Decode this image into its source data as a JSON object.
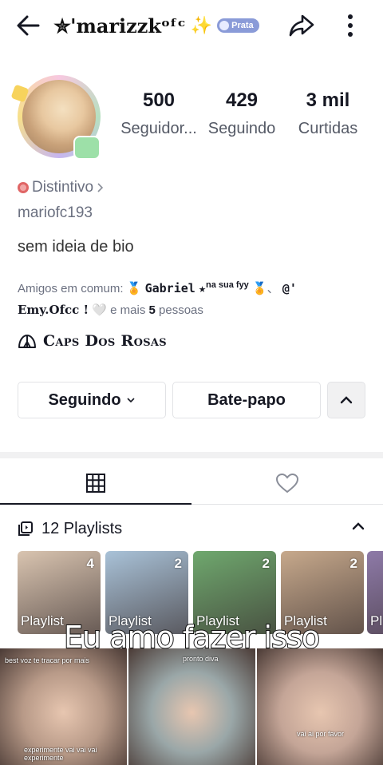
{
  "header": {
    "title": "✮'marizzkᵒᶠᶜ",
    "title_emoji": "✨",
    "badge_label": "Prata",
    "icons": {
      "back": "back-arrow-icon",
      "share": "share-icon",
      "more": "more-vertical-icon"
    }
  },
  "profile": {
    "stats": [
      {
        "value": "500",
        "label": "Seguidor..."
      },
      {
        "value": "429",
        "label": "Seguindo"
      },
      {
        "value": "3 mil",
        "label": "Curtidas"
      }
    ],
    "distintivo_label": "Distintivo",
    "username": "mariofc193",
    "bio": "sem ideia de bio",
    "friends": {
      "prefix": "Amigos em comum:",
      "friend1_name": "Gabriel",
      "friend1_suffix": "na sua fyy",
      "friend2_prefix": "@'",
      "friend2_name": "Emy.Ofcc !",
      "heart": "🤍",
      "and_more": "e mais",
      "more_count": "5",
      "more_suffix": "pessoas"
    },
    "group_name": "Caps Dos Rosas"
  },
  "actions": {
    "following_label": "Seguindo",
    "chat_label": "Bate-papo"
  },
  "tabs": [
    {
      "name": "videos",
      "icon": "grid-icon",
      "active": true
    },
    {
      "name": "liked",
      "icon": "heart-outline-icon",
      "active": false
    }
  ],
  "playlists": {
    "title": "12 Playlists",
    "items": [
      {
        "count": "4",
        "label": "Playlist",
        "color": "#d9c4b0"
      },
      {
        "count": "2",
        "label": "Playlist",
        "color": "#a9c2d8"
      },
      {
        "count": "2",
        "label": "Playlist",
        "color": "#6fa86e"
      },
      {
        "count": "2",
        "label": "Playlist",
        "color": "#c7a98c"
      },
      {
        "count": "",
        "label": "Pl",
        "color": "#8e7aa8"
      }
    ]
  },
  "videos": [
    {
      "caption": "best voz te tracar por mais",
      "caption2": "experimente vai vai vai experimente",
      "color": "#b89a88"
    },
    {
      "caption": "pronto diva",
      "caption2": "",
      "color": "#9aa7a8"
    },
    {
      "caption": "",
      "caption2": "vai ai por favor",
      "color": "#c4a597"
    }
  ],
  "overlay_caption": "Eu amo fazer isso"
}
